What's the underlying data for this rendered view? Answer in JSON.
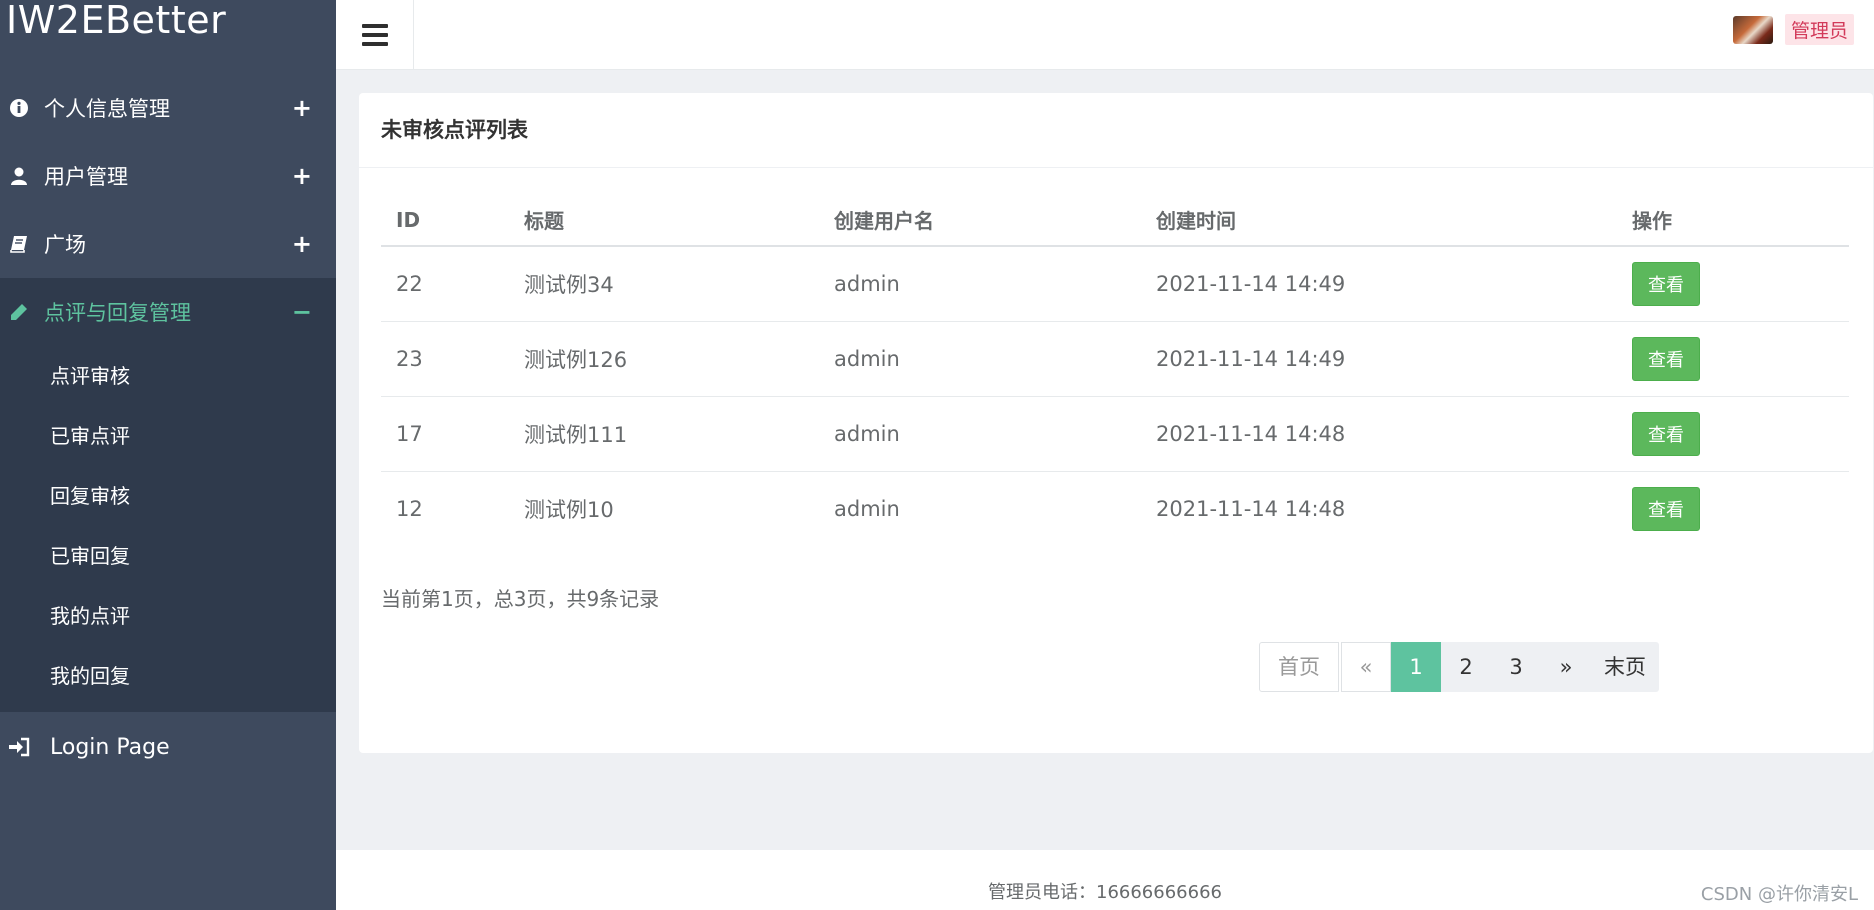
{
  "sidebar": {
    "brand": "IW2EBetter",
    "items": [
      {
        "label": "个人信息管理",
        "toggle": "+",
        "icon": "info-icon"
      },
      {
        "label": "用户管理",
        "toggle": "+",
        "icon": "user-icon"
      },
      {
        "label": "广场",
        "toggle": "+",
        "icon": "book-icon"
      },
      {
        "label": "点评与回复管理",
        "toggle": "−",
        "icon": "pencil-icon"
      }
    ],
    "submenu": [
      "点评审核",
      "已审点评",
      "回复审核",
      "已审回复",
      "我的点评",
      "我的回复"
    ],
    "login": {
      "label": "Login Page",
      "icon": "sign-in-icon"
    }
  },
  "topbar": {
    "role": "管理员"
  },
  "panel": {
    "title": "未审核点评列表",
    "columns": [
      "ID",
      "标题",
      "创建用户名",
      "创建时间",
      "操作"
    ],
    "rows": [
      {
        "id": "22",
        "title": "测试例34",
        "user": "admin",
        "time": "2021-11-14 14:49",
        "action": "查看"
      },
      {
        "id": "23",
        "title": "测试例126",
        "user": "admin",
        "time": "2021-11-14 14:49",
        "action": "查看"
      },
      {
        "id": "17",
        "title": "测试例111",
        "user": "admin",
        "time": "2021-11-14 14:48",
        "action": "查看"
      },
      {
        "id": "12",
        "title": "测试例10",
        "user": "admin",
        "time": "2021-11-14 14:48",
        "action": "查看"
      }
    ],
    "page_info": "当前第1页，总3页，共9条记录",
    "pagination": {
      "first": "首页",
      "prev": "«",
      "pages": [
        "1",
        "2",
        "3"
      ],
      "current": "1",
      "next": "»",
      "last": "末页"
    }
  },
  "footer": {
    "text": "管理员电话：16666666666",
    "watermark": "CSDN @许你清安L"
  },
  "colors": {
    "sidebar_bg": "#3e4a5e",
    "accent": "#5ec39f",
    "button_green": "#5cb85c",
    "role_badge_text": "#d23a5a"
  }
}
